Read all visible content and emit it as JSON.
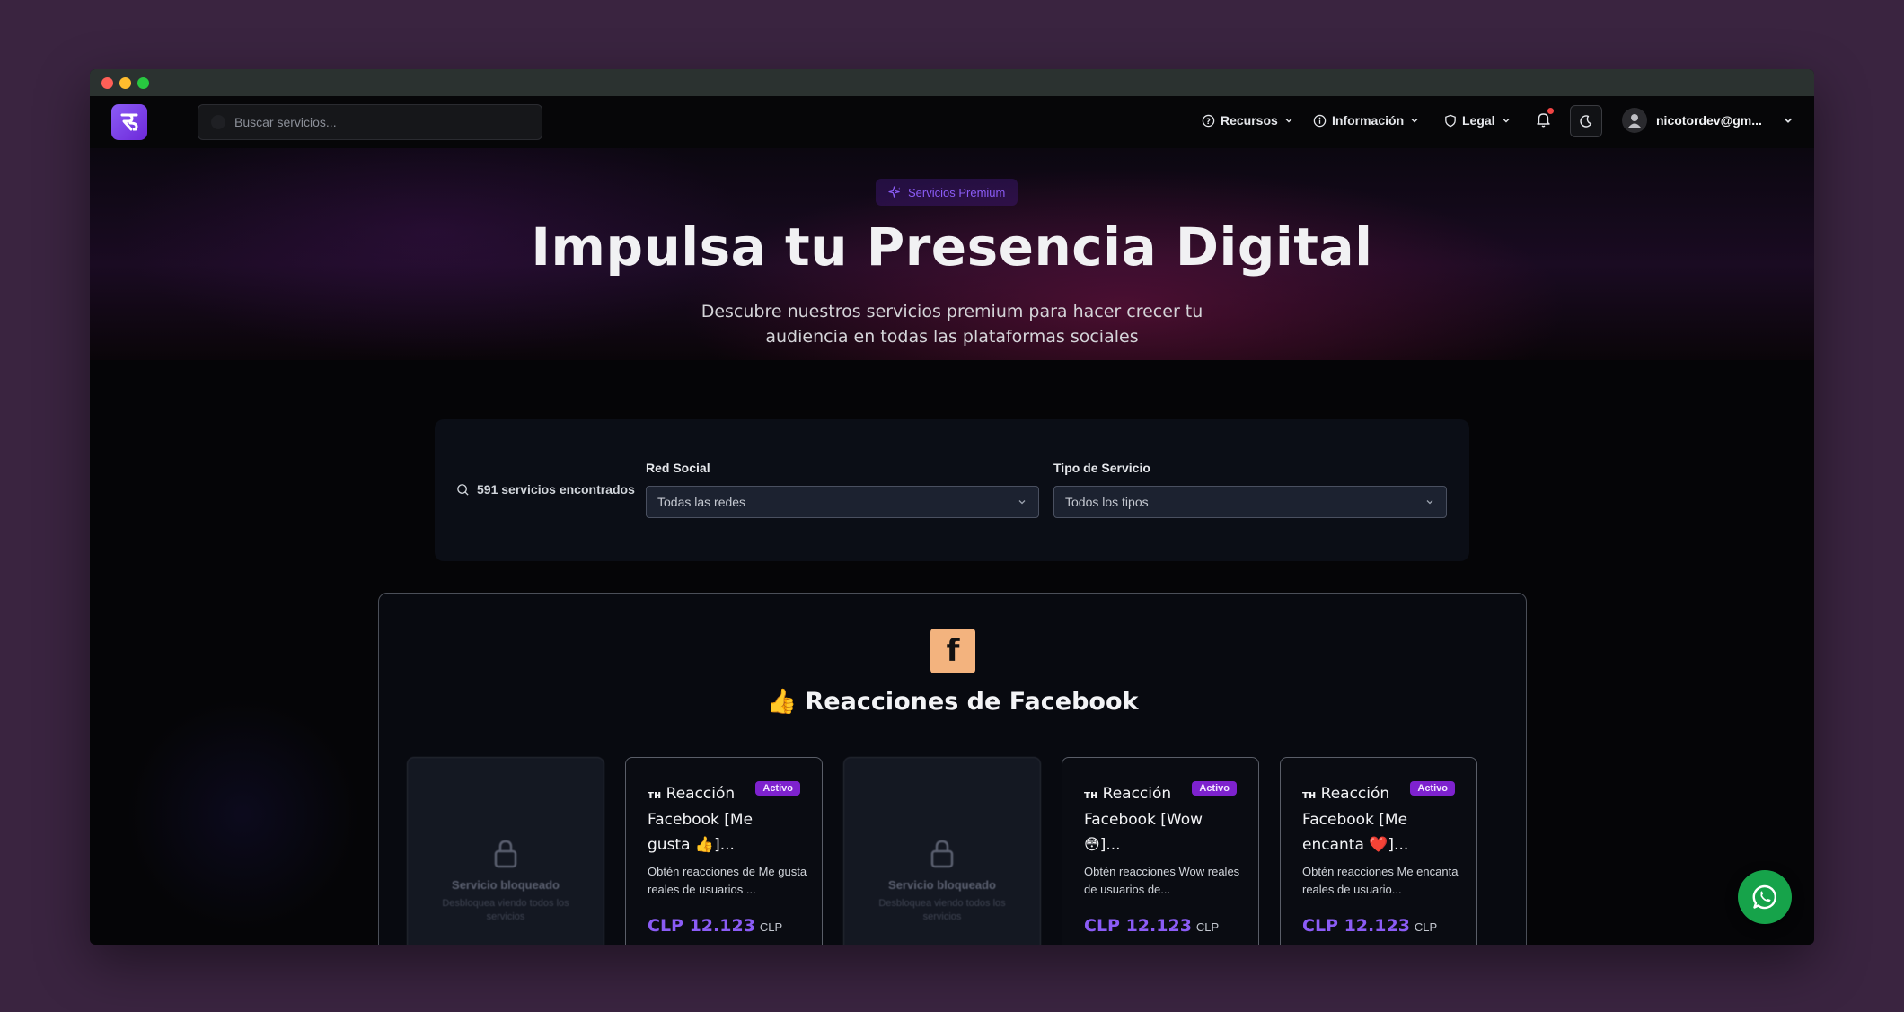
{
  "colors": {
    "accent": "#8b5cf6",
    "badge": "#7e22ce",
    "whatsapp": "#16a34a"
  },
  "header": {
    "search_placeholder": "Buscar servicios...",
    "nav": [
      {
        "label": "Recursos",
        "icon": "help-circle-icon"
      },
      {
        "label": "Información",
        "icon": "info-icon"
      },
      {
        "label": "Legal",
        "icon": "shield-icon"
      }
    ],
    "user_email": "nicotordev@gm..."
  },
  "hero": {
    "pill": "Servicios Premium",
    "title": "Impulsa tu Presencia Digital",
    "subtitle": "Descubre nuestros servicios premium para hacer crecer tu audiencia en todas las plataformas sociales"
  },
  "filters": {
    "count": "591 servicios encontrados",
    "social_label": "Red Social",
    "social_value": "Todas las redes",
    "type_label": "Tipo de Servicio",
    "type_value": "Todos los tipos"
  },
  "section": {
    "title": "👍 Reacciones de Facebook",
    "icon_letter": "f",
    "cards": [
      {
        "locked": true,
        "lock_title": "Servicio bloqueado",
        "lock_sub": "Desbloquea viendo todos los servicios"
      },
      {
        "locked": false,
        "prefix": "ᴛʜ",
        "title": "Reacción Facebook [Me gusta 👍]...",
        "badge": "Activo",
        "desc": "Obtén reacciones de Me gusta reales de usuarios ...",
        "price": "CLP 12.123",
        "currency": "CLP"
      },
      {
        "locked": true,
        "lock_title": "Servicio bloqueado",
        "lock_sub": "Desbloquea viendo todos los servicios"
      },
      {
        "locked": false,
        "prefix": "ᴛʜ",
        "title": "Reacción Facebook [Wow 😳]...",
        "badge": "Activo",
        "desc": "Obtén reacciones Wow reales de usuarios de...",
        "price": "CLP 12.123",
        "currency": "CLP"
      },
      {
        "locked": false,
        "prefix": "ᴛʜ",
        "title": "Reacción Facebook [Me encanta ❤️]...",
        "badge": "Activo",
        "desc": "Obtén reacciones Me encanta reales de usuario...",
        "price": "CLP 12.123",
        "currency": "CLP"
      }
    ]
  }
}
